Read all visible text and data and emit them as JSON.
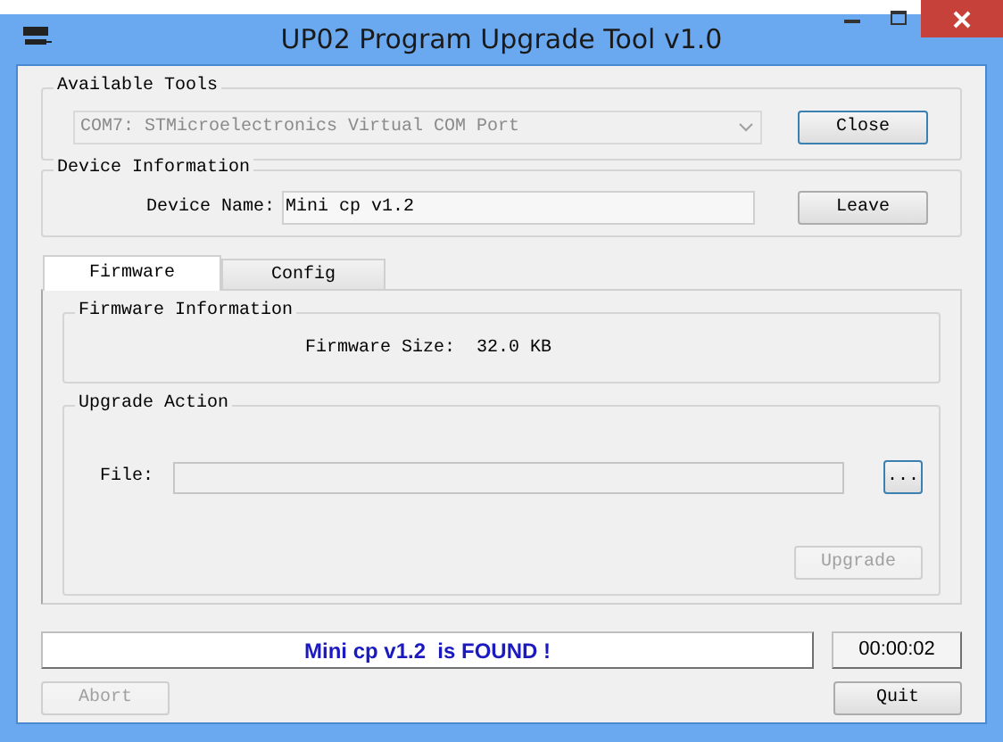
{
  "window": {
    "title": "UP02 Program Upgrade Tool v1.0"
  },
  "available_tools": {
    "title": "Available Tools",
    "port": {
      "value": "COM7: STMicroelectronics Virtual COM Port",
      "disabled": true
    },
    "button": {
      "label": "Close",
      "disabled": false
    }
  },
  "device_information": {
    "title": "Device Information",
    "label": "Device Name:",
    "value": "Mini cp v1.2",
    "button": {
      "label": "Leave",
      "disabled": false
    }
  },
  "tabs": [
    {
      "label": "Firmware",
      "selected": true
    },
    {
      "label": "Config",
      "selected": false
    }
  ],
  "firmware_information": {
    "title": "Firmware Information",
    "label": "Firmware Size:",
    "value": "32.0 KB"
  },
  "upgrade_action": {
    "title": "Upgrade Action",
    "file_label": "File:",
    "browse_button": {
      "label": "...",
      "disabled": false
    },
    "upgrade_button": {
      "label": "Upgrade",
      "disabled": true
    }
  },
  "status": {
    "message": "Mini cp v1.2  is FOUND !",
    "timer": "00:00:02"
  },
  "buttons": [
    {
      "label": "Abort",
      "disabled": true
    },
    {
      "label": "Quit",
      "disabled": false
    }
  ]
}
